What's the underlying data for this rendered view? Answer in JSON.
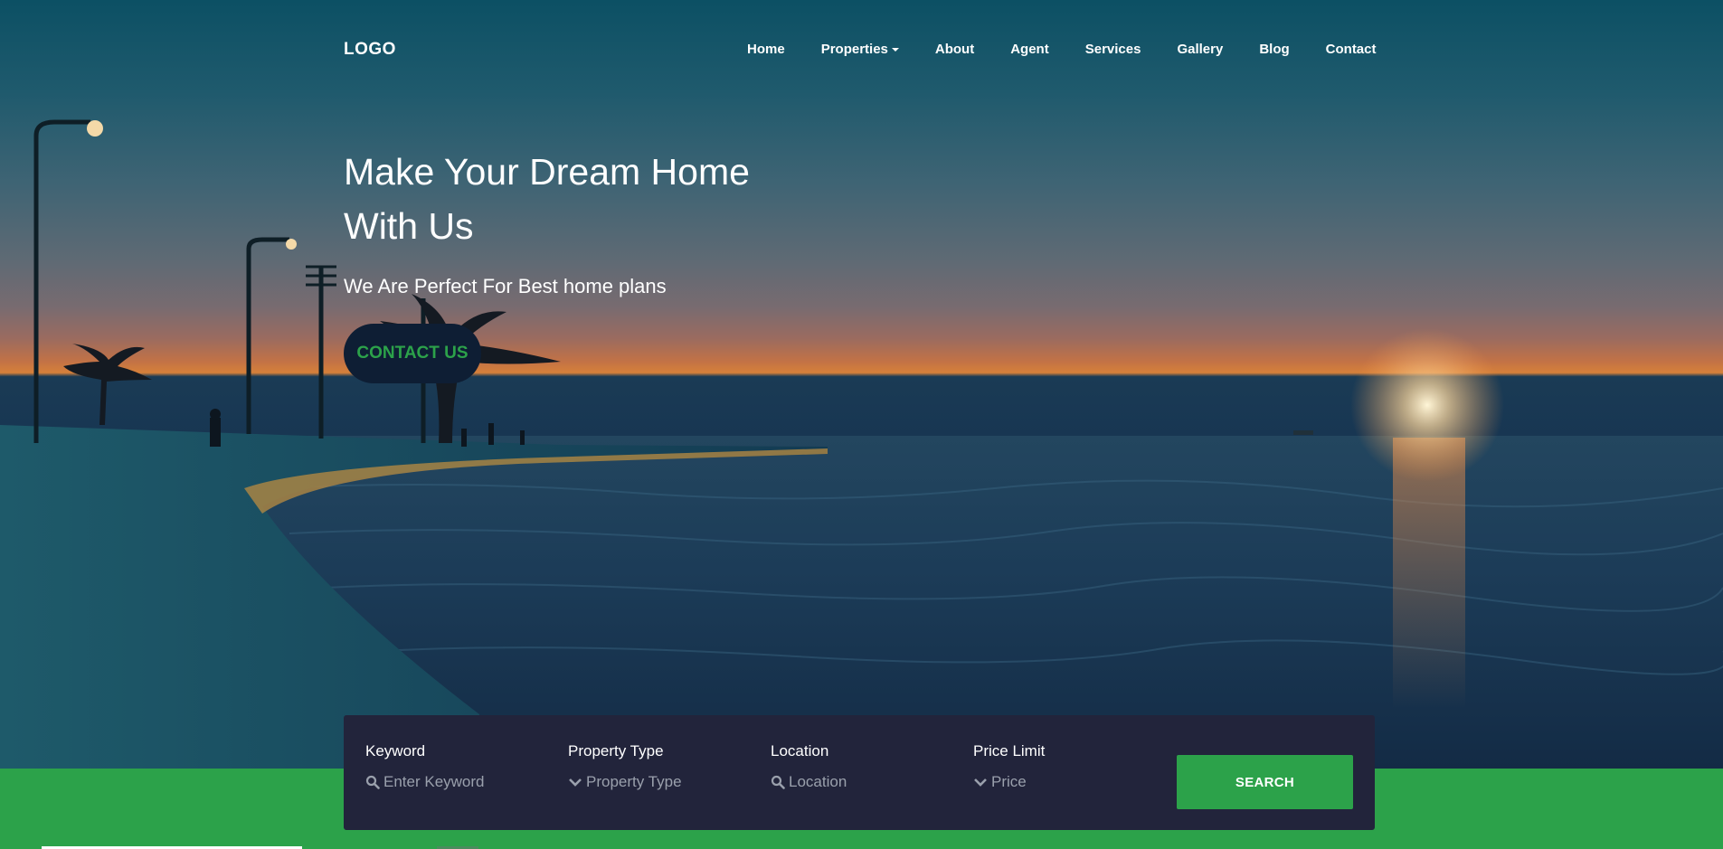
{
  "brand": {
    "logo": "LOGO"
  },
  "nav": {
    "items": [
      {
        "label": "Home"
      },
      {
        "label": "Properties",
        "has_dropdown": true
      },
      {
        "label": "About"
      },
      {
        "label": "Agent"
      },
      {
        "label": "Services"
      },
      {
        "label": "Gallery"
      },
      {
        "label": "Blog"
      },
      {
        "label": "Contact"
      }
    ]
  },
  "hero": {
    "title": "Make Your Dream Home With Us",
    "subtitle": "We Are Perfect For Best home plans",
    "cta_label": "CONTACT US"
  },
  "search": {
    "fields": [
      {
        "label": "Keyword",
        "placeholder": "Enter Keyword",
        "icon": "search-icon"
      },
      {
        "label": "Property Type",
        "placeholder": "Property Type",
        "icon": "chevron-down-icon"
      },
      {
        "label": "Location",
        "placeholder": "Location",
        "icon": "search-icon"
      },
      {
        "label": "Price Limit",
        "placeholder": "Price",
        "icon": "chevron-down-icon"
      }
    ],
    "button_label": "SEARCH"
  },
  "colors": {
    "accent_green": "#2ca24a",
    "panel_dark": "#22243b",
    "cta_bg": "#0e1e34"
  }
}
